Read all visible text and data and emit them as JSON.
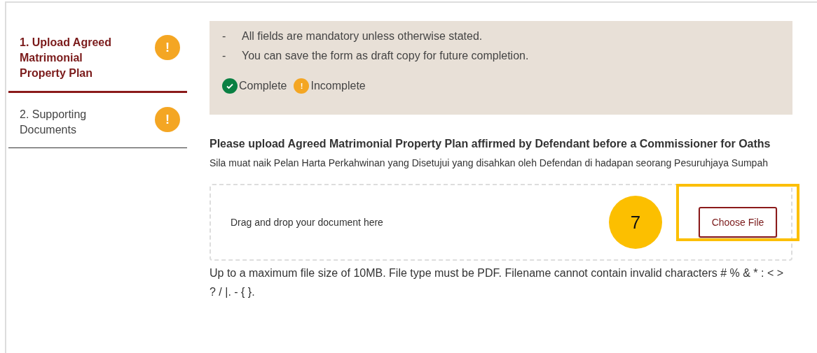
{
  "steps": [
    {
      "label": "1. Upload Agreed Matrimonial Property Plan",
      "selected": true,
      "complete": false,
      "status_icon": "!"
    },
    {
      "label": "2. Supporting Documents",
      "selected": false,
      "complete": false,
      "status_icon": "!"
    }
  ],
  "notice": {
    "bullets": [
      {
        "marker": "-",
        "text": "All fields are mandatory unless otherwise stated."
      },
      {
        "marker": "-",
        "text": "You can save the form as draft copy for future completion."
      }
    ],
    "legend": [
      {
        "kind": "complete",
        "label": "Complete"
      },
      {
        "kind": "incomplete",
        "label": "Incomplete",
        "icon": "!"
      }
    ]
  },
  "upload": {
    "title": "Please upload Agreed Matrimonial Property Plan affirmed by Defendant before a Commissioner for Oaths",
    "subtitle": "Sila muat naik Pelan Harta Perkahwinan yang Disetujui yang disahkan oleh Defendan di hadapan seorang Pesuruhjaya Sumpah",
    "drop_text": "Drag and drop your document here",
    "button": "Choose File",
    "callout": "7",
    "note": "Up to a maximum file size of 10MB. File type must be PDF. Filename cannot contain invalid characters # % & * : < > ? / |. - { }."
  }
}
